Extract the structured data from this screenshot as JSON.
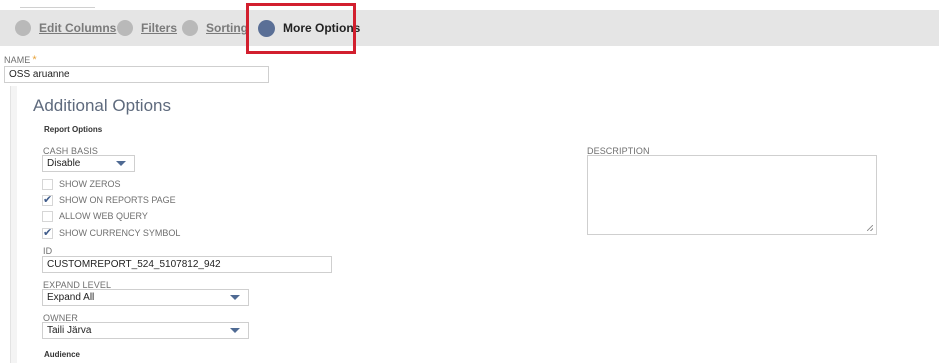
{
  "tabs": [
    {
      "label": "Edit Columns"
    },
    {
      "label": "Filters"
    },
    {
      "label": "Sorting"
    },
    {
      "label": "More Options"
    }
  ],
  "active_tab": "More Options",
  "highlight_color": "#d21f2e",
  "name": {
    "label": "NAME",
    "required_mark": "*",
    "value": "OSS aruanne"
  },
  "section_title": "Additional Options",
  "report_options": {
    "title": "Report Options",
    "cash_basis": {
      "label": "CASH BASIS",
      "value": "Disable"
    },
    "checkboxes": [
      {
        "label": "SHOW ZEROS",
        "checked": false
      },
      {
        "label": "SHOW ON REPORTS PAGE",
        "checked": true
      },
      {
        "label": "ALLOW WEB QUERY",
        "checked": false
      },
      {
        "label": "SHOW CURRENCY SYMBOL",
        "checked": true
      }
    ],
    "id": {
      "label": "ID",
      "value": "CUSTOMREPORT_524_5107812_942"
    },
    "expand_level": {
      "label": "EXPAND LEVEL",
      "value": "Expand All"
    },
    "owner": {
      "label": "OWNER",
      "value": "Taili Järva"
    }
  },
  "description": {
    "label": "DESCRIPTION",
    "value": ""
  },
  "audience_title": "Audience",
  "check_glyph": "✔",
  "check_color": "#3f5b8a"
}
